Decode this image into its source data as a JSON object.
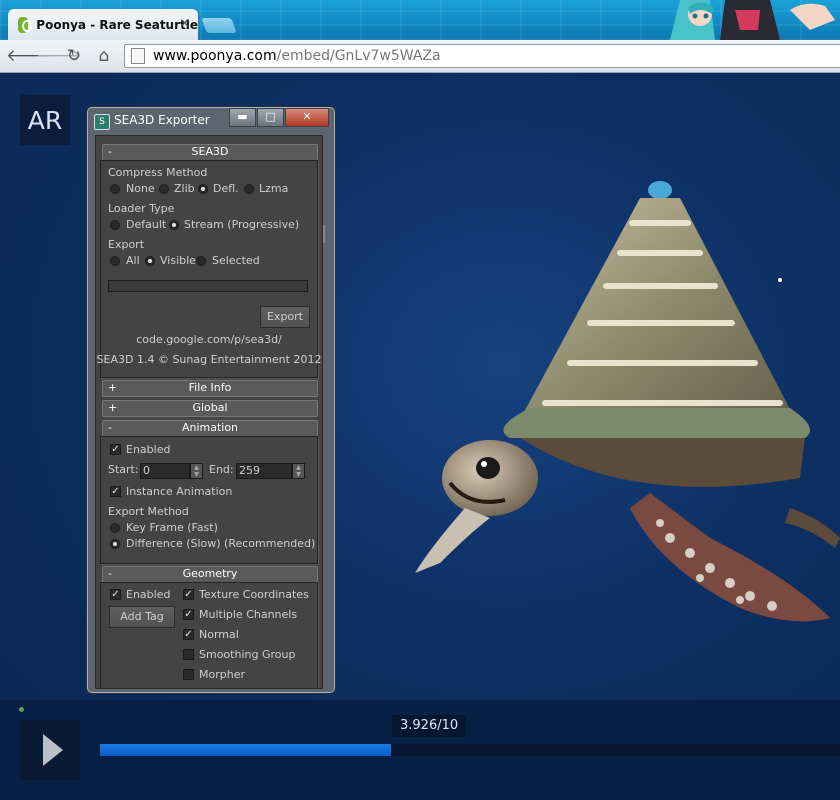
{
  "browser": {
    "tab_title": "Poonya - Rare Seaturtle",
    "tab_close": "×",
    "url_host": "www.poonya.com",
    "url_path": "/embed/GnLv7w5WAZa"
  },
  "viewer": {
    "badge": "AR",
    "time_label": "3.926/10",
    "progress_fraction": 0.3926
  },
  "dialog": {
    "title": "SEA3D Exporter",
    "sea3d_rollout": {
      "sign": "-",
      "title": "SEA3D",
      "compress_label": "Compress Method",
      "compress_options": [
        "None",
        "Zlib",
        "Defl.",
        "Lzma"
      ],
      "compress_selected": "Defl.",
      "loader_label": "Loader Type",
      "loader_options": [
        "Default",
        "Stream (Progressive)"
      ],
      "loader_selected": "Stream (Progressive)",
      "export_label": "Export",
      "export_options": [
        "All",
        "Visible",
        "Selected"
      ],
      "export_selected": "Visible",
      "export_button": "Export",
      "link": "code.google.com/p/sea3d/",
      "version": "SEA3D 1.4 © Sunag Entertainment 2012"
    },
    "file_info_rollout": {
      "sign": "+",
      "title": "File Info"
    },
    "global_rollout": {
      "sign": "+",
      "title": "Global"
    },
    "animation_rollout": {
      "sign": "-",
      "title": "Animation",
      "enabled_label": "Enabled",
      "enabled": true,
      "start_label": "Start:",
      "start_value": "0",
      "end_label": "End:",
      "end_value": "259",
      "instance_label": "Instance Animation",
      "instance": true,
      "method_label": "Export Method",
      "method_options": [
        "Key Frame (Fast)",
        "Difference (Slow) (Recommended)"
      ],
      "method_selected": "Difference (Slow) (Recommended)"
    },
    "geometry_rollout": {
      "sign": "-",
      "title": "Geometry",
      "enabled_label": "Enabled",
      "enabled": true,
      "add_tag_button": "Add Tag",
      "options": [
        {
          "label": "Texture Coordinates",
          "checked": true
        },
        {
          "label": "Multiple Channels",
          "checked": true
        },
        {
          "label": "Normal",
          "checked": true
        },
        {
          "label": "Smoothing Group",
          "checked": false
        },
        {
          "label": "Morpher",
          "checked": false
        }
      ]
    }
  },
  "colors": {
    "progress": "#1a7be0",
    "background": "#0b2a55"
  }
}
